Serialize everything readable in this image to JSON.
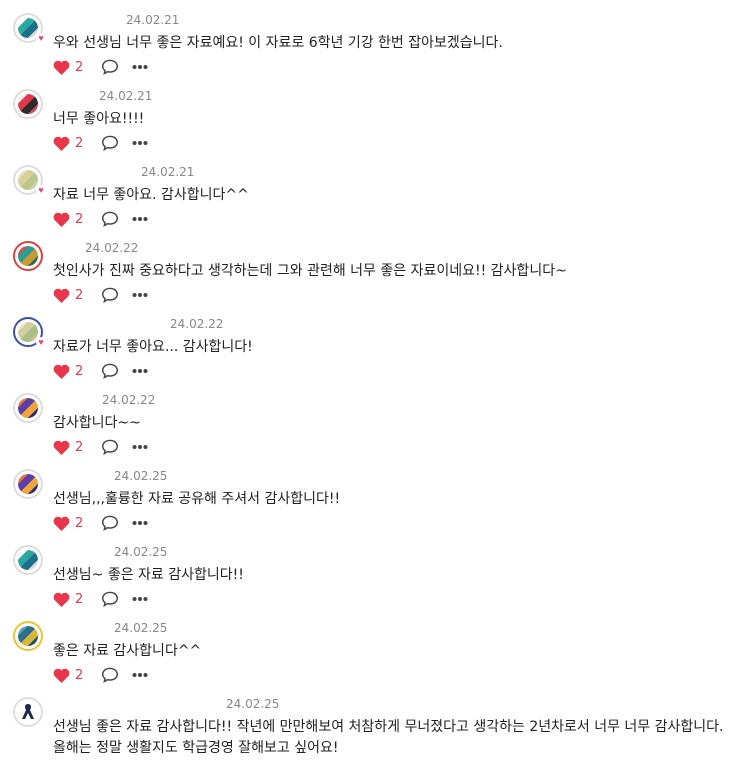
{
  "colors": {
    "heart": "#e8364a",
    "date": "#888888",
    "text": "#222222",
    "badge_heart": "#e8407a"
  },
  "icons": {
    "like": "heart-icon",
    "reply": "speech-bubble-icon",
    "more": "ellipsis-icon",
    "avatar_badge": "heart-badge-icon"
  },
  "comments": [
    {
      "date": "24.02.21",
      "text": "우와 선생님 너무 좋은 자료예요! 이 자료로 6학년 기강 한번 잡아보겠습니다.",
      "likes": "2",
      "avatar_colors": [
        "#2aa8a0",
        "#1e6f8a",
        "#f4f4f4",
        "#d9d9d9"
      ],
      "badge": true
    },
    {
      "date": "24.02.21",
      "text": "너무 좋아요!!!!",
      "likes": "2",
      "avatar_colors": [
        "#e2394a",
        "#2b2b2b",
        "#e8e8e8",
        "#c64a5a"
      ],
      "badge": false
    },
    {
      "date": "24.02.21",
      "text": "자료 너무 좋아요. 감사합니다^^",
      "likes": "2",
      "avatar_colors": [
        "#d9cf9a",
        "#b9c98e",
        "#e8e0c2",
        "#cbd4a8"
      ],
      "badge": true
    },
    {
      "date": "24.02.22",
      "text": "첫인사가 진짜 중요하다고 생각하는데 그와 관련해 너무 좋은 자료이네요!! 감사합니다~",
      "likes": "2",
      "avatar_colors": [
        "#2f9d8f",
        "#c99a32",
        "#e3484d",
        "#2a6b55"
      ],
      "badge": false
    },
    {
      "date": "24.02.22",
      "text": "자료가 너무 좋아요... 감사합니다!",
      "likes": "2",
      "avatar_colors": [
        "#d4cda0",
        "#a9bf8a",
        "#ece6c8",
        "#c9c08d"
      ],
      "badge": true
    },
    {
      "date": "24.02.22",
      "text": "감사합니다~~",
      "likes": "2",
      "avatar_colors": [
        "#5b3fa8",
        "#f0a43a",
        "#e8703a",
        "#2d2f7a"
      ],
      "badge": false
    },
    {
      "date": "24.02.25",
      "text": "선생님,,,훌륭한 자료 공유해 주셔서 감사합니다!!",
      "likes": "2",
      "avatar_colors": [
        "#5b3fa8",
        "#f0a43a",
        "#e8703a",
        "#2d2f7a"
      ],
      "badge": false
    },
    {
      "date": "24.02.25",
      "text": "선생님~ 좋은 자료 감사합니다!!",
      "likes": "2",
      "avatar_colors": [
        "#2aa8a0",
        "#1e6f8a",
        "#f4f4f4",
        "#d9d9d9"
      ],
      "badge": false
    },
    {
      "date": "24.02.25",
      "text": "좋은 자료 감사합니다^^",
      "likes": "2",
      "avatar_colors": [
        "#2c6f88",
        "#d9b63b",
        "#5a9fb8",
        "#1f4f60"
      ],
      "badge": false
    },
    {
      "date": "24.02.25",
      "text": "선생님 좋은 자료 감사합니다!! 작년에 만만해보여 처참하게 무너졌다고 생각하는 2년차로서 너무 너무 감사합니다. 올해는 정말 생활지도 학급경영 잘해보고 싶어요!",
      "likes": "",
      "avatar_colors": [
        "#1e2a4a",
        "#1e2a4a",
        "#ffffff",
        "#ffffff"
      ],
      "badge": false
    }
  ]
}
